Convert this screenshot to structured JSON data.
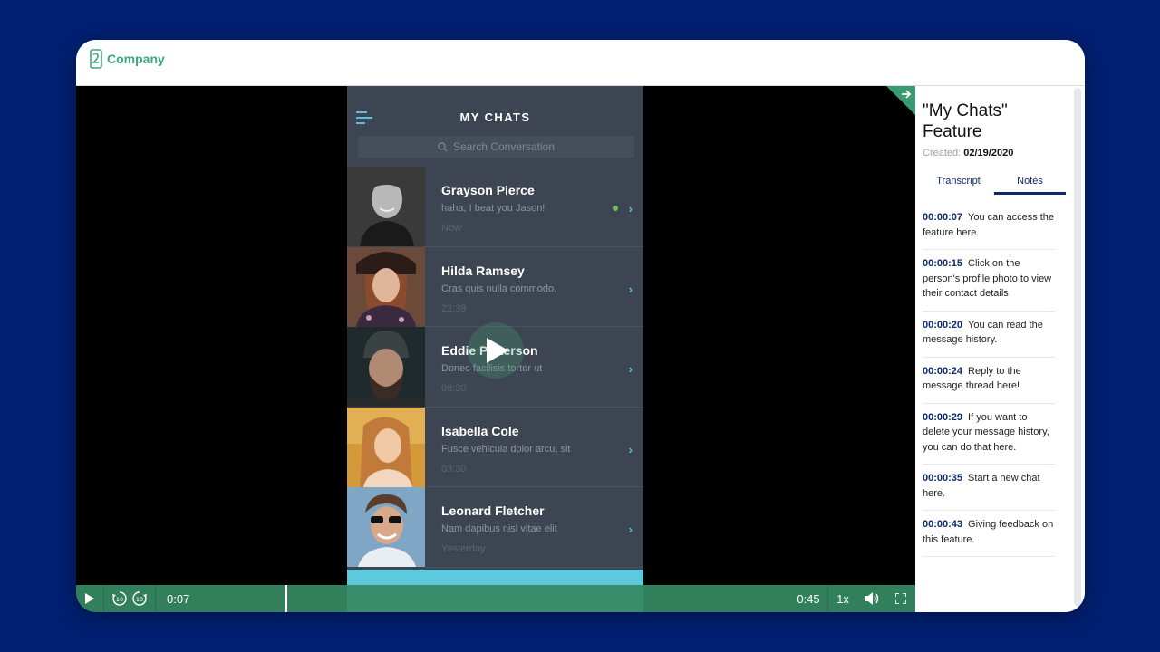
{
  "brand": {
    "name": "Company",
    "color": "#3aa97f"
  },
  "phone": {
    "title": "MY CHATS",
    "search_placeholder": "Search Conversation",
    "chats": [
      {
        "name": "Grayson Pierce",
        "message": "haha, I beat you Jason!",
        "time": "Now",
        "online": true
      },
      {
        "name": "Hilda Ramsey",
        "message": "Cras quis nulla commodo,",
        "time": "22:39",
        "online": false
      },
      {
        "name": "Eddie Patterson",
        "message": "Donec facilisis tortor ut",
        "time": "08:30",
        "online": false
      },
      {
        "name": "Isabella Cole",
        "message": "Fusce vehicula dolor arcu, sit",
        "time": "03:30",
        "online": false
      },
      {
        "name": "Leonard Fletcher",
        "message": "Nam dapibus nisl vitae elit",
        "time": "Yesterday",
        "online": false
      }
    ]
  },
  "player": {
    "current_time": "0:07",
    "total_time": "0:45",
    "speed": "1x",
    "progress": 0.155,
    "icons": {
      "play": "play-icon",
      "rewind": "rewind-10-icon",
      "forward": "forward-10-icon",
      "volume": "volume-icon",
      "fullscreen": "fullscreen-icon"
    },
    "accent": "#368a62"
  },
  "panel": {
    "title": "\"My Chats\" Feature",
    "created_label": "Created:",
    "created_date": "02/19/2020",
    "tabs": [
      {
        "label": "Transcript",
        "active": false
      },
      {
        "label": "Notes",
        "active": true
      }
    ],
    "notes": [
      {
        "time": "00:00:07",
        "text": "You can access the feature here."
      },
      {
        "time": "00:00:15",
        "text": "Click on the person's profile photo to view their contact details"
      },
      {
        "time": "00:00:20",
        "text": "You can read the message history."
      },
      {
        "time": "00:00:24",
        "text": "Reply to the message thread here!"
      },
      {
        "time": "00:00:29",
        "text": "If you want to delete your message history, you can do that here."
      },
      {
        "time": "00:00:35",
        "text": "Start a new chat here."
      },
      {
        "time": "00:00:43",
        "text": "Giving feedback on this feature."
      }
    ]
  }
}
